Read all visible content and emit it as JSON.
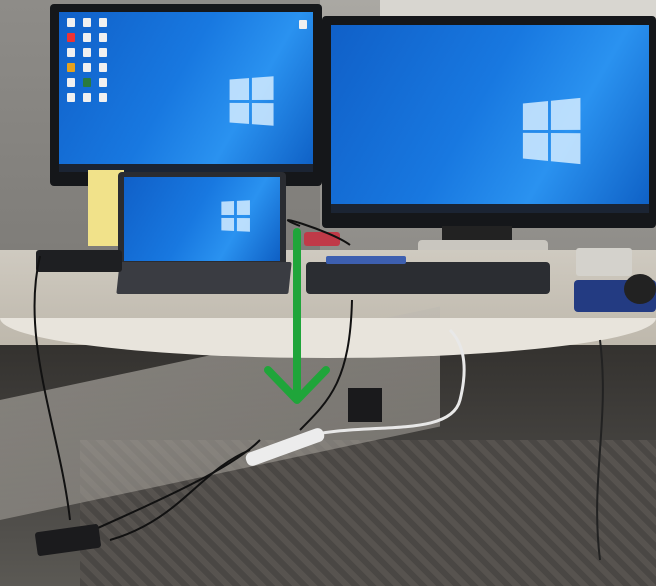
{
  "scene": {
    "arrow_color": "#1fa53a",
    "screen_color": "#1878e0"
  },
  "icons": {
    "arrow": "green-down-arrow",
    "logo": "windows-logo"
  }
}
